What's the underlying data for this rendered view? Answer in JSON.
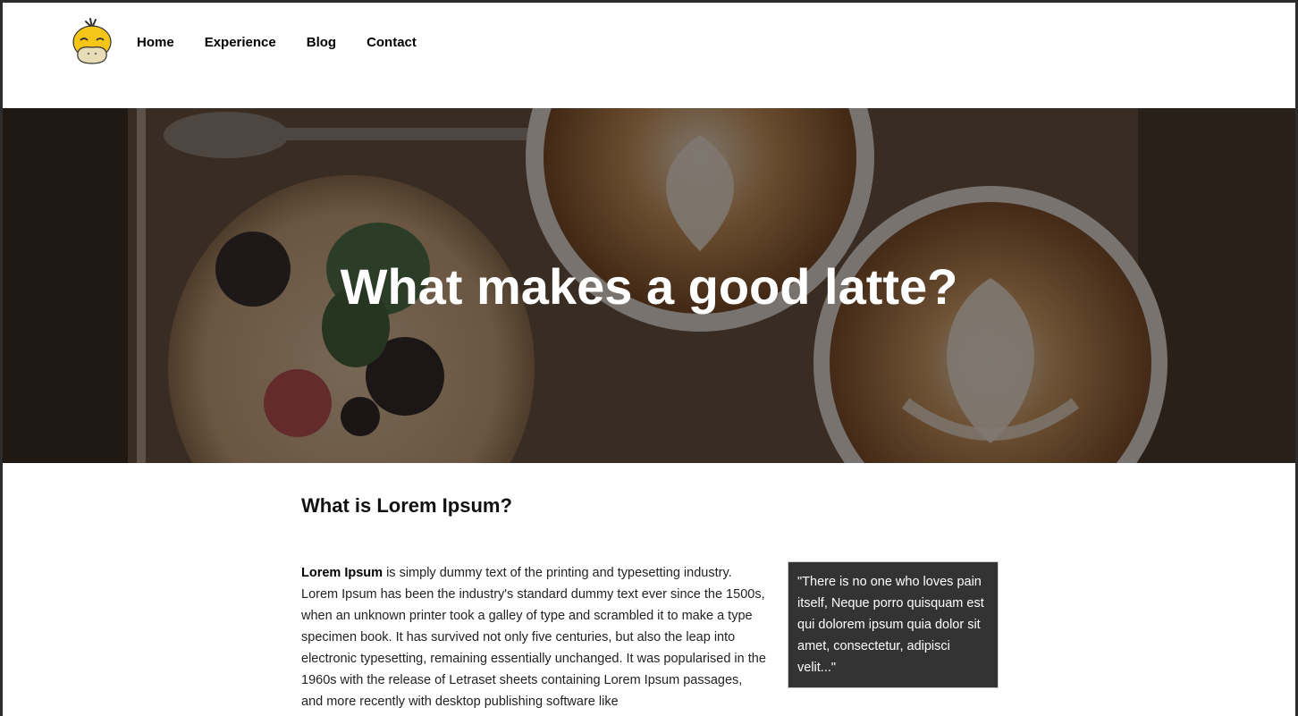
{
  "nav": {
    "items": [
      {
        "label": "Home"
      },
      {
        "label": "Experience"
      },
      {
        "label": "Blog"
      },
      {
        "label": "Contact"
      }
    ]
  },
  "hero": {
    "title": "What makes a good latte?"
  },
  "article": {
    "heading": "What is Lorem Ipsum?",
    "lead_bold": "Lorem Ipsum",
    "body": " is simply dummy text of the printing and typesetting industry. Lorem Ipsum has been the industry's standard dummy text ever since the 1500s, when an unknown printer took a galley of type and scrambled it to make a type specimen book. It has survived not only five centuries, but also the leap into electronic typesetting, remaining essentially unchanged. It was popularised in the 1960s with the release of Letraset sheets containing Lorem Ipsum passages, and more recently with desktop publishing software like",
    "quote": "\"There is no one who loves pain itself, Neque porro quisquam est qui dolorem ipsum quia dolor sit amet, consectetur, adipisci velit...\""
  },
  "colors": {
    "quote_bg": "#333333",
    "hero_overlay": "#1e1814"
  },
  "icons": {
    "logo": "duck-logo-icon"
  }
}
